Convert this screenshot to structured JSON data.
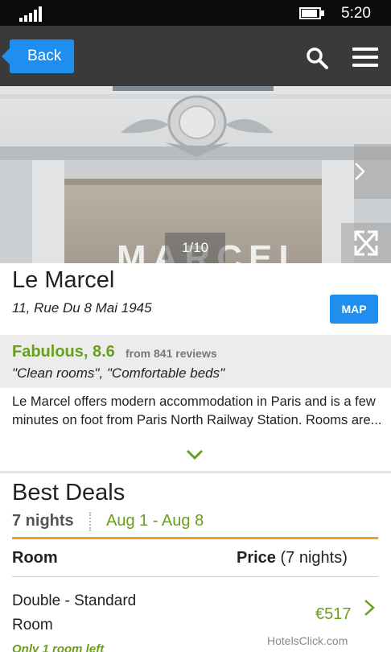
{
  "status_bar": {
    "time": "5:20",
    "signal_icon": "signal-bars-icon",
    "battery_icon": "battery-charging-icon"
  },
  "header": {
    "back_label": "Back",
    "search_icon": "search-icon",
    "menu_icon": "hamburger-menu-icon"
  },
  "gallery": {
    "counter": "1/10",
    "next_icon": "chevron-right-icon",
    "expand_icon": "expand-fullscreen-icon"
  },
  "hotel": {
    "name": "Le Marcel",
    "address": "11, Rue Du 8 Mai 1945",
    "map_label": "MAP"
  },
  "rating": {
    "label": "Fabulous, 8.6",
    "reviews": "from 841 reviews",
    "quote": "\"Clean rooms\", \"Comfortable beds\""
  },
  "description": {
    "text": "Le Marcel offers modern accommodation in Paris and is a few minutes on foot from Paris North Railway Station. Rooms are...",
    "expand_icon": "chevron-down-icon"
  },
  "deals": {
    "title": "Best Deals",
    "nights": "7 nights",
    "dates": "Aug 1 - Aug 8",
    "col_room": "Room",
    "col_price_bold": "Price",
    "col_price_suffix": " (7 nights)",
    "rooms": [
      {
        "name": "Double - Standard Room",
        "price": "€517",
        "availability": "Only 1 room left"
      }
    ]
  },
  "watermark": "HotelsClick.com",
  "colors": {
    "accent_blue": "#1f8ef1",
    "rating_green": "#6a9e1f",
    "header_gray": "#3a3a3a",
    "divider_orange": "#f0a020"
  }
}
